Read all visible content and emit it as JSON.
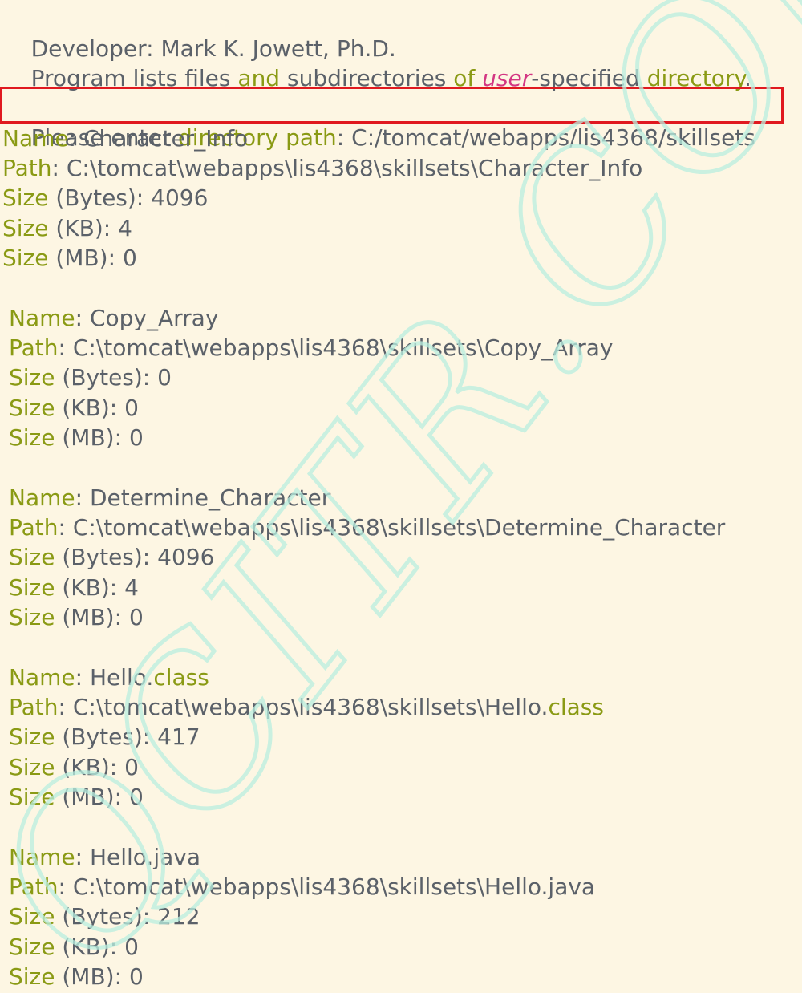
{
  "header": {
    "developer_label": "Developer:",
    "developer_name": " Mark K. Jowett, Ph.D.",
    "desc_1": "Program lists files ",
    "desc_and": "and",
    "desc_2": " subdirectories ",
    "desc_of": "of",
    "desc_3": " ",
    "desc_user": "user",
    "desc_4": "-specified ",
    "desc_directory": "directory",
    "desc_5": "."
  },
  "prompt": {
    "label_1": "Please enter ",
    "label_kw": "directory path",
    "label_2": ": ",
    "value": "C:/tomcat/webapps/lis4368/skillsets"
  },
  "labels": {
    "name": "Name",
    "path": "Path",
    "size": "Size",
    "bytes": " (Bytes): ",
    "kb": " (KB): ",
    "mb": " (MB): ",
    "colon": ": "
  },
  "entries": [
    {
      "name_a": "Character_Info",
      "name_ext": "",
      "path_a": "C:\\tomcat\\webapps\\lis4368\\skillsets\\Character_Info",
      "path_ext": "",
      "bytes": "4096",
      "kb": "4",
      "mb": "0"
    },
    {
      "name_a": "Copy_Array",
      "name_ext": "",
      "path_a": "C:\\tomcat\\webapps\\lis4368\\skillsets\\Copy_Array",
      "path_ext": "",
      "bytes": "0",
      "kb": "0",
      "mb": "0"
    },
    {
      "name_a": "Determine_Character",
      "name_ext": "",
      "path_a": "C:\\tomcat\\webapps\\lis4368\\skillsets\\Determine_Character",
      "path_ext": "",
      "bytes": "4096",
      "kb": "4",
      "mb": "0"
    },
    {
      "name_a": "Hello.",
      "name_ext": "class",
      "path_a": "C:\\tomcat\\webapps\\lis4368\\skillsets\\Hello.",
      "path_ext": "class",
      "bytes": "417",
      "kb": "0",
      "mb": "0"
    },
    {
      "name_a": "Hello.java",
      "name_ext": "",
      "path_a": "C:\\tomcat\\webapps\\lis4368\\skillsets\\Hello.java",
      "path_ext": "",
      "bytes": "212",
      "kb": "0",
      "mb": "0"
    }
  ],
  "watermark": {
    "text": "QCITR.COM"
  },
  "colors": {
    "background": "#fdf6e3",
    "text": "#5b6169",
    "keyword": "#8a9a14",
    "italic_keyword": "#d33682",
    "highlight_border": "#e0191f",
    "watermark": "#b9efe0"
  }
}
